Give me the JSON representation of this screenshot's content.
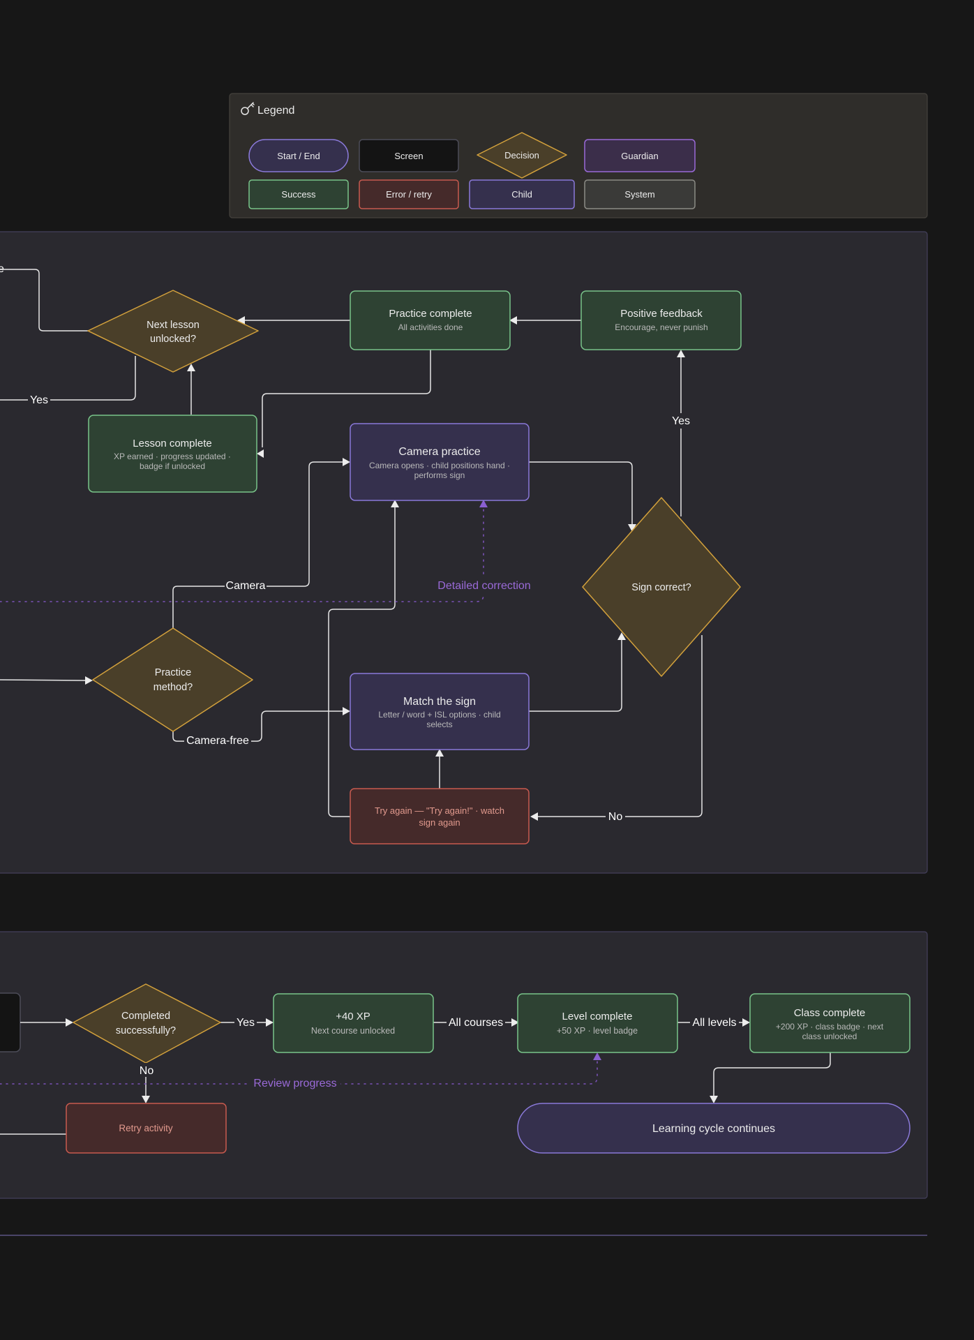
{
  "legend": {
    "title": "Legend",
    "icon": "key-icon",
    "items": [
      "Start / End",
      "Screen",
      "Decision",
      "Guardian",
      "Success",
      "Error / retry",
      "Child",
      "System"
    ]
  },
  "colors": {
    "background": "#171717",
    "panel": "#2a292f",
    "panel_border": "#44405c",
    "legend_panel": "#2f2d2a",
    "success_fill": "#2e4233",
    "success_stroke": "#79c48a",
    "decision_fill": "#4a3f29",
    "decision_stroke": "#d3a13c",
    "child_fill": "#35304d",
    "child_stroke": "#8a79d9",
    "error_fill": "#452a2a",
    "error_stroke": "#c85a4f",
    "guardian_fill": "#3b2e4a",
    "guardian_stroke": "#9a6ad8",
    "system_fill": "#3a3a38",
    "system_stroke": "#8c8c86",
    "screen_fill": "#141414",
    "screen_stroke": "#4c4c58",
    "connector": "#e6e6e6",
    "dashed_connector": "#7b52b8"
  },
  "nodes": {
    "next_lesson": {
      "title": "Next lesson unlocked?"
    },
    "practice_complete": {
      "title": "Practice complete",
      "subtitle": "All activities done"
    },
    "positive_feedback": {
      "title": "Positive feedback",
      "subtitle": "Encourage, never punish"
    },
    "lesson_complete": {
      "title": "Lesson complete",
      "subtitle": "XP earned · progress updated · badge if unlocked"
    },
    "camera_practice": {
      "title": "Camera practice",
      "subtitle": "Camera opens · child positions hand · performs sign"
    },
    "sign_correct": {
      "title": "Sign correct?"
    },
    "practice_method": {
      "title": "Practice method?"
    },
    "match_sign": {
      "title": "Match the sign",
      "subtitle": "Letter / word + ISL options · child selects"
    },
    "try_again": {
      "title": "Try again — \"Try again!\" · watch sign again"
    },
    "completed": {
      "title": "Completed successfully?"
    },
    "xp40": {
      "title": "+40 XP",
      "subtitle": "Next course unlocked"
    },
    "level_complete": {
      "title": "Level complete",
      "subtitle": "+50 XP · level badge"
    },
    "class_complete": {
      "title": "Class complete",
      "subtitle": "+200 XP · class badge · next class unlocked"
    },
    "retry_activity": {
      "title": "Retry activity"
    },
    "learning_cycle": {
      "title": "Learning cycle continues"
    }
  },
  "edge_labels": {
    "top_left_clipped": "e",
    "yes_next_lesson": "Yes",
    "yes_sign_correct": "Yes",
    "camera": "Camera",
    "camera_free": "Camera-free",
    "detailed_correction": "Detailed correction",
    "no_sign_correct": "No",
    "yes_completed": "Yes",
    "no_completed": "No",
    "all_courses": "All courses",
    "all_levels": "All levels",
    "review_progress": "Review progress"
  }
}
